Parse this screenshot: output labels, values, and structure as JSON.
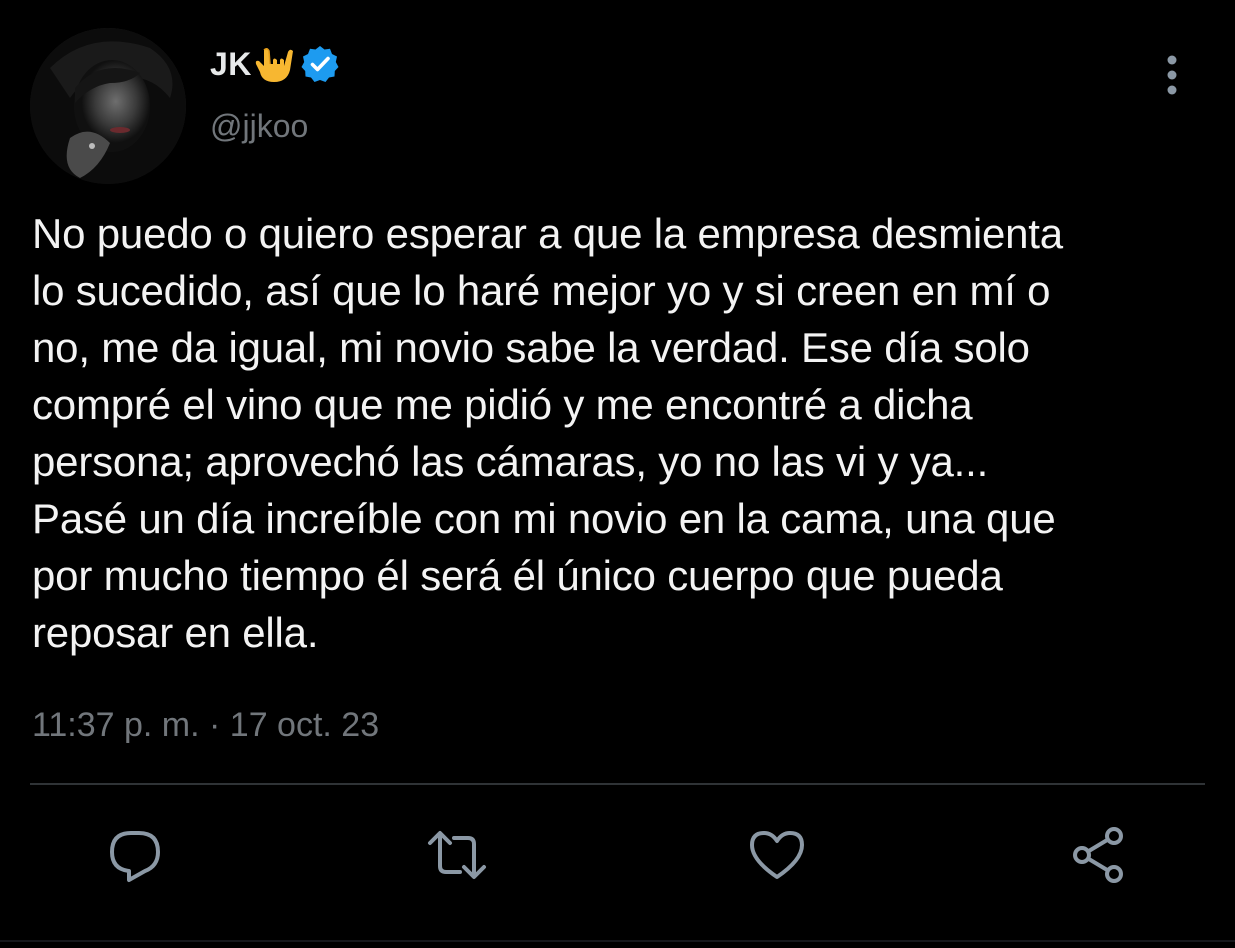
{
  "user": {
    "display_name": "JK",
    "handle": "@jjkoo"
  },
  "tweet": {
    "text": "No puedo o quiero esperar a que la empresa desmienta\nlo sucedido, así que lo haré mejor yo y si creen en mí o\nno, me da igual, mi novio sabe la verdad. Ese día solo\ncompré el vino que me pidió y me encontré a dicha\npersona; aprovechó las cámaras, yo no las vi y ya...\nPasé un día increíble con mi novio en la cama, una que\npor mucho tiempo él será él único cuerpo que pueda\nreposar en ella.",
    "timestamp": "11:37 p. m. · 17 oct. 23"
  },
  "icons": {
    "emoji": "sign-of-horns-emoji",
    "verified": "verified-badge-icon",
    "more": "more-vertical-icon",
    "reply": "reply-icon",
    "retweet": "retweet-icon",
    "like": "heart-icon",
    "share": "share-icon"
  },
  "colors": {
    "background": "#000000",
    "text": "#e7e9ea",
    "secondary_text": "#71767b",
    "verified_blue": "#1d9bf0",
    "emoji_yellow": "#f7b731",
    "icon_gray": "#8b98a5",
    "divider": "#2f3336"
  }
}
